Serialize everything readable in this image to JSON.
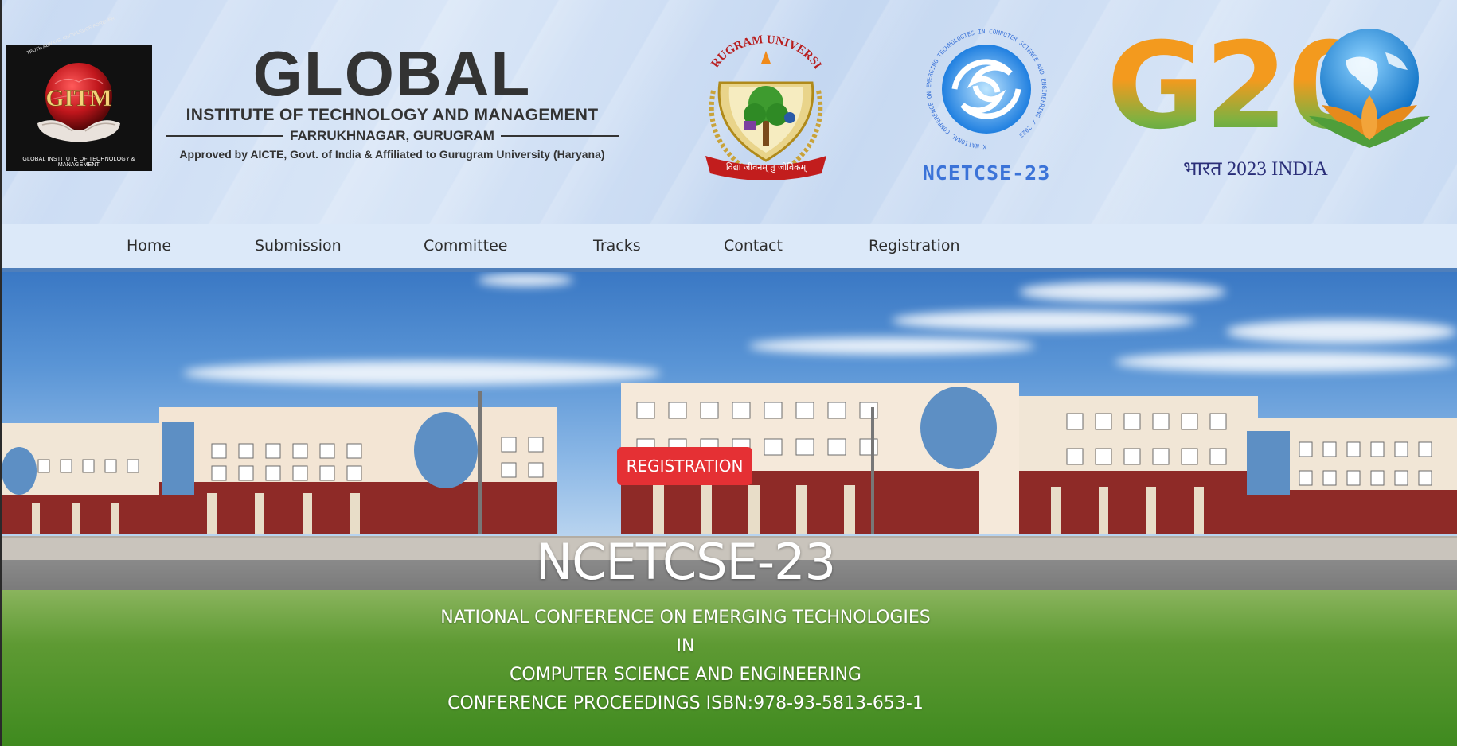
{
  "header": {
    "gitm_logo": {
      "motto": "TRUTH ALWAYS, KNOWLEDGE FOREVER",
      "word": "GITM",
      "caption": "GLOBAL INSTITUTE OF TECHNOLOGY & MANAGEMENT"
    },
    "institute": {
      "name_main": "GLOBAL",
      "name_sub": "INSTITUTE OF TECHNOLOGY AND MANAGEMENT",
      "location": "FARRUKHNAGAR, GURUGRAM",
      "approval": "Approved by AICTE, Govt. of India & Affiliated to Gurugram University (Haryana)"
    },
    "gurugram_logo": {
      "title": "GURUGRAM UNIVERSITY",
      "motto": "विद्या जीवनम् तु जीविकम्"
    },
    "ncetcse_logo": {
      "ring_text": "X NATIONAL CONFERENCE ON EMERGING TECHNOLOGIES IN COMPUTER SCIENCE AND ENGINEERING X 2023",
      "label": "NCETCSE-23"
    },
    "g20_logo": {
      "word": "G20",
      "caption": "भारत 2023 INDIA"
    }
  },
  "nav": {
    "items": [
      {
        "label": "Home"
      },
      {
        "label": "Submission"
      },
      {
        "label": "Committee"
      },
      {
        "label": "Tracks"
      },
      {
        "label": "Contact"
      },
      {
        "label": "Registration"
      }
    ]
  },
  "hero": {
    "title": "NCETCSE-23",
    "lines": [
      "NATIONAL CONFERENCE ON EMERGING TECHNOLOGIES",
      "IN",
      "COMPUTER SCIENCE AND ENGINEERING",
      "CONFERENCE PROCEEDINGS ISBN:978-93-5813-653-1"
    ],
    "button_label": "REGISTRATION"
  },
  "colors": {
    "header_bg": "#c9dbf3",
    "nav_bg": "#dce9f9",
    "nav_border": "#4f7fbb",
    "button_red": "#e53034",
    "ncet_blue": "#3b73d8",
    "g20_orange": "#f39a1e",
    "g20_green": "#35a04a"
  }
}
